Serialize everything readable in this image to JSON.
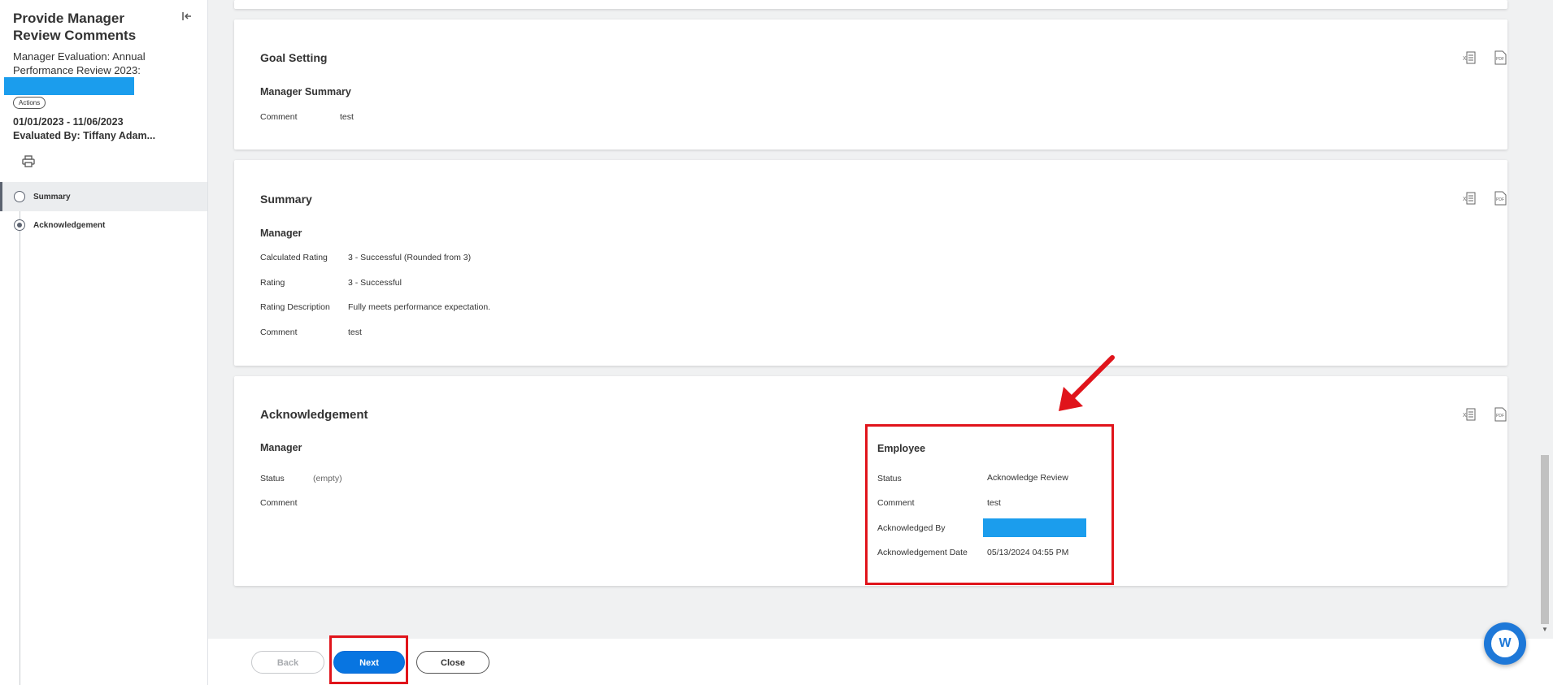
{
  "sidebar": {
    "title": "Provide Manager Review Comments",
    "subtitle": "Manager Evaluation: Annual Performance Review 2023:",
    "actions_label": "Actions",
    "dates": "01/01/2023 - 11/06/2023",
    "evaluated_by": "Evaluated By: Tiffany Adam...",
    "steps": [
      {
        "label": "Summary",
        "active": true
      },
      {
        "label": "Acknowledgement",
        "active": false
      }
    ]
  },
  "cards": {
    "goal_setting": {
      "title": "Goal Setting",
      "subheading": "Manager Summary",
      "comment_label": "Comment",
      "comment_value": "test"
    },
    "summary": {
      "title": "Summary",
      "subheading": "Manager",
      "rows": [
        {
          "label": "Calculated Rating",
          "value": "3 - Successful (Rounded from 3)"
        },
        {
          "label": "Rating",
          "value": "3 - Successful"
        },
        {
          "label": "Rating Description",
          "value": "Fully meets performance expectation."
        },
        {
          "label": "Comment",
          "value": "test"
        }
      ]
    },
    "acknowledgement": {
      "title": "Acknowledgement",
      "manager": {
        "subheading": "Manager",
        "status_label": "Status",
        "status_value": "(empty)",
        "comment_label": "Comment"
      },
      "employee": {
        "subheading": "Employee",
        "status_label": "Status",
        "status_value": "Acknowledge Review",
        "comment_label": "Comment",
        "comment_value": "test",
        "ack_by_label": "Acknowledged By",
        "ack_date_label": "Acknowledgement Date",
        "ack_date_value": "05/13/2024 04:55 PM"
      }
    }
  },
  "export_icons": {
    "excel": "excel-export-icon",
    "pdf": "pdf-export-icon",
    "pdf_text": "PDF"
  },
  "footer": {
    "back_label": "Back",
    "next_label": "Next",
    "close_label": "Close"
  },
  "fab_letter": "W",
  "colors": {
    "primary": "#0875e1",
    "highlight": "#e0141b",
    "redaction": "#1b9ded"
  }
}
